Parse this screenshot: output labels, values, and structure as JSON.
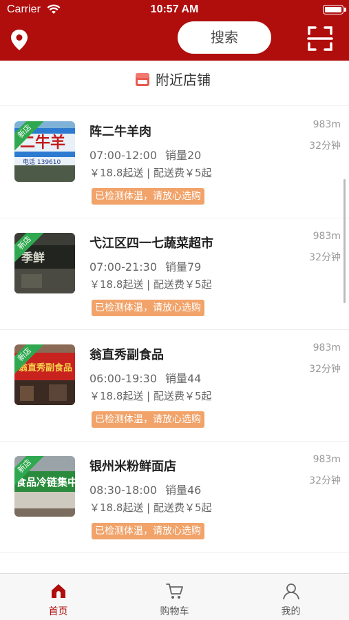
{
  "status_bar": {
    "carrier": "Carrier",
    "time": "10:57 AM"
  },
  "header": {
    "search_label": "搜索",
    "location_icon": "location-pin-icon",
    "scan_icon": "scan-icon"
  },
  "section": {
    "title": "附近店铺",
    "icon": "store-icon"
  },
  "stores": [
    {
      "name": "阵二牛羊肉",
      "hours": "07:00-12:00",
      "sales": "销量20",
      "fee": "￥18.8起送 | 配送费￥5起",
      "tag": "已检测体温，请放心选购",
      "distance": "983m",
      "eta": "32分钟",
      "badge": "新店"
    },
    {
      "name": "弋江区四一七蔬菜超市",
      "hours": "07:00-21:30",
      "sales": "销量79",
      "fee": "￥18.8起送 | 配送费￥5起",
      "tag": "已检测体温，请放心选购",
      "distance": "983m",
      "eta": "32分钟",
      "badge": "新店"
    },
    {
      "name": "翁直秀副食品",
      "hours": "06:00-19:30",
      "sales": "销量44",
      "fee": "￥18.8起送 | 配送费￥5起",
      "tag": "已检测体温，请放心选购",
      "distance": "983m",
      "eta": "32分钟",
      "badge": "新店"
    },
    {
      "name": "银州米粉鲜面店",
      "hours": "08:30-18:00",
      "sales": "销量46",
      "fee": "￥18.8起送 | 配送费￥5起",
      "tag": "已检测体温，请放心选购",
      "distance": "983m",
      "eta": "32分钟",
      "badge": "新店"
    }
  ],
  "tabbar": {
    "tabs": [
      {
        "label": "首页",
        "icon": "home-icon",
        "active": true
      },
      {
        "label": "购物车",
        "icon": "cart-icon",
        "active": false
      },
      {
        "label": "我的",
        "icon": "profile-icon",
        "active": false
      }
    ]
  },
  "colors": {
    "brand": "#b00d0d",
    "new_badge": "#2fa84f",
    "tag": "#f1a36a"
  }
}
